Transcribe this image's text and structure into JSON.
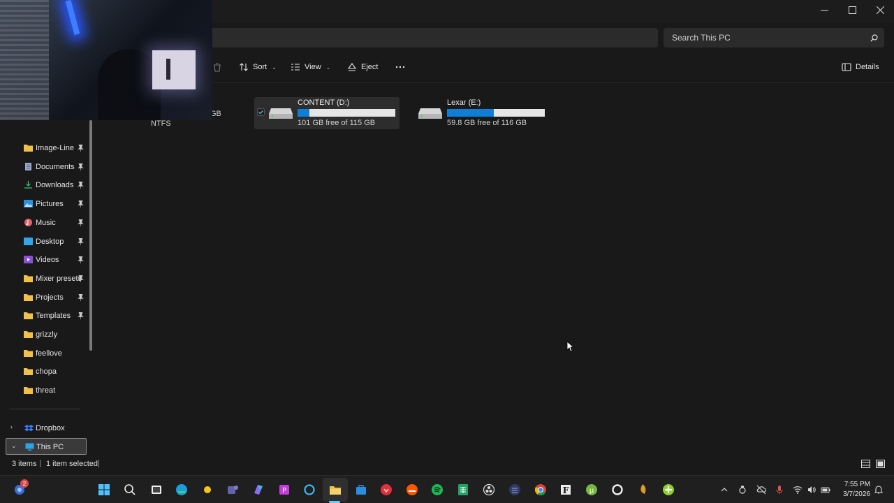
{
  "search": {
    "placeholder": "Search This PC"
  },
  "toolbar": {
    "sort_label": "Sort",
    "view_label": "View",
    "eject_label": "Eject",
    "details_label": "Details"
  },
  "drives": [
    {
      "name": "CONTENT (D:)",
      "free_text": "101 GB free of 115 GB",
      "used_fraction": 0.12,
      "selected": true
    },
    {
      "name": "Lexar (E:)",
      "free_text": "59.8 GB free of 116 GB",
      "used_fraction": 0.48,
      "selected": false
    }
  ],
  "partial_drive": {
    "size_fragment": "GB",
    "fs_label": "NTFS"
  },
  "sidebar": {
    "quick_access": [
      {
        "label": "Image-Line",
        "icon": "folder-icon",
        "pinned": true
      },
      {
        "label": "Documents",
        "icon": "documents-icon",
        "pinned": true
      },
      {
        "label": "Downloads",
        "icon": "download-icon",
        "pinned": true
      },
      {
        "label": "Pictures",
        "icon": "pictures-icon",
        "pinned": true
      },
      {
        "label": "Music",
        "icon": "music-icon",
        "pinned": true
      },
      {
        "label": "Desktop",
        "icon": "desktop-icon",
        "pinned": true
      },
      {
        "label": "Videos",
        "icon": "videos-icon",
        "pinned": true
      },
      {
        "label": "Mixer presets",
        "icon": "folder-icon",
        "pinned": true
      },
      {
        "label": "Projects",
        "icon": "folder-icon",
        "pinned": true
      },
      {
        "label": "Templates",
        "icon": "folder-icon",
        "pinned": true
      },
      {
        "label": "grizzly",
        "icon": "folder-icon",
        "pinned": false
      },
      {
        "label": "feellove",
        "icon": "folder-icon",
        "pinned": false
      },
      {
        "label": "chopa",
        "icon": "folder-icon",
        "pinned": false
      },
      {
        "label": "threat",
        "icon": "folder-icon",
        "pinned": false
      }
    ],
    "dropbox_label": "Dropbox",
    "this_pc_label": "This PC"
  },
  "status": {
    "items": "3 items",
    "selected": "1 item selected"
  },
  "taskbar": {
    "notification_count": "2",
    "time": "7:55 PM",
    "date": "3/7/2026"
  },
  "colors": {
    "accent": "#0e7fd8",
    "folder": "#f0c04a",
    "background": "#191919"
  }
}
